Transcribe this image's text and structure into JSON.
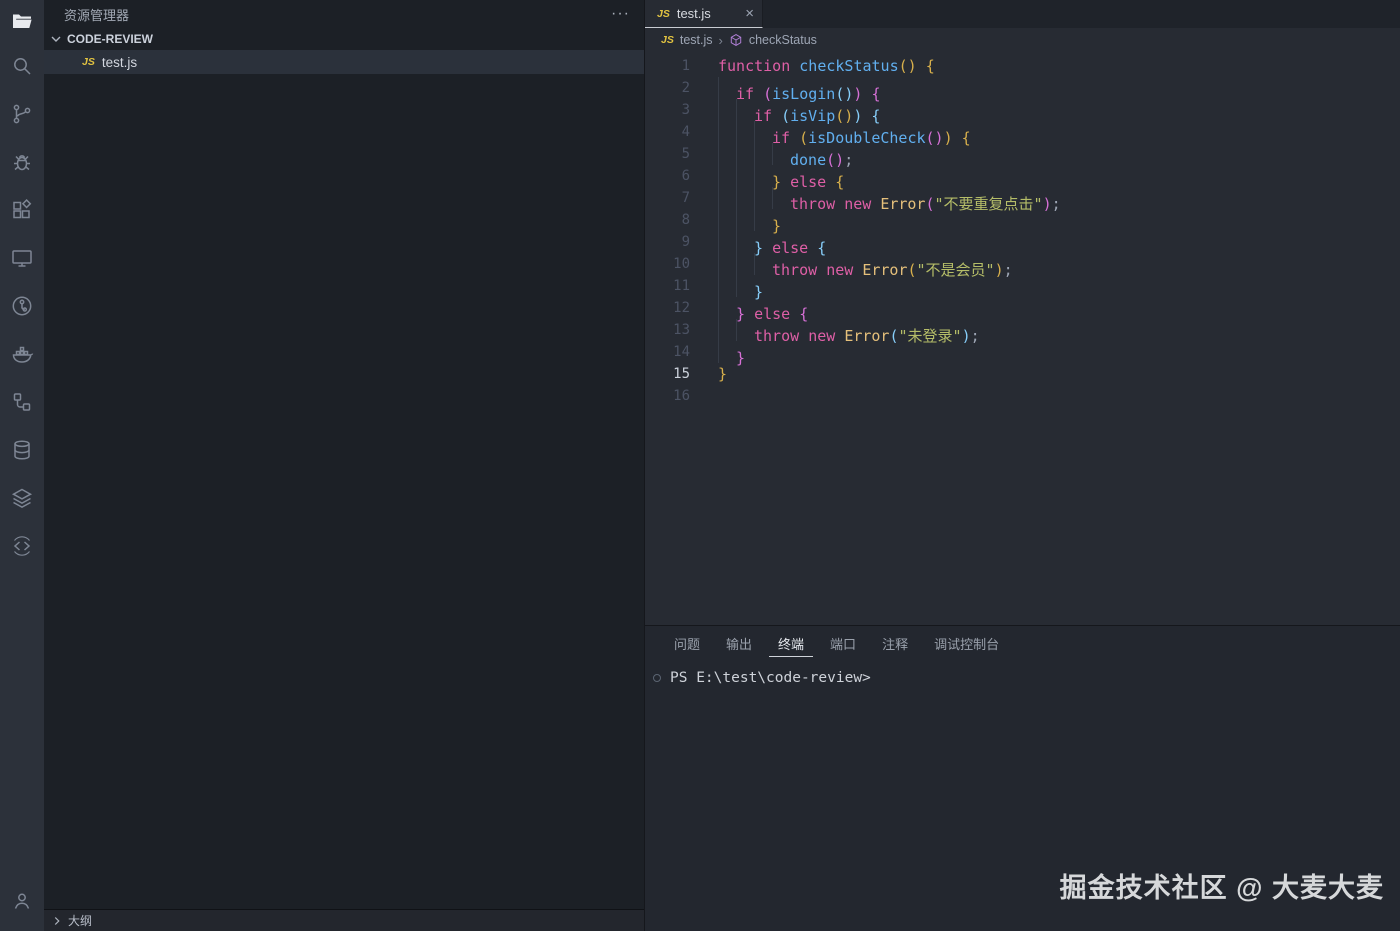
{
  "activity_bar": {
    "items": [
      {
        "name": "explorer",
        "active": true
      },
      {
        "name": "search",
        "active": false
      },
      {
        "name": "source-control",
        "active": false
      },
      {
        "name": "run-debug",
        "active": false
      },
      {
        "name": "extensions",
        "active": false
      },
      {
        "name": "remote-explorer",
        "active": false
      },
      {
        "name": "git-graph",
        "active": false
      },
      {
        "name": "docker",
        "active": false
      },
      {
        "name": "flow",
        "active": false
      },
      {
        "name": "database",
        "active": false
      },
      {
        "name": "layers",
        "active": false
      },
      {
        "name": "code-sync",
        "active": false
      }
    ],
    "bottom_item": {
      "name": "account",
      "active": false
    }
  },
  "sidebar": {
    "title": "资源管理器",
    "more_label": "···",
    "section_label": "CODE-REVIEW",
    "file": {
      "badge": "JS",
      "name": "test.js"
    },
    "outline_label": "大纲"
  },
  "editor": {
    "tab": {
      "badge": "JS",
      "title": "test.js",
      "close_label": "×"
    },
    "breadcrumb": {
      "badge": "JS",
      "file": "test.js",
      "separator": "›",
      "symbol": "checkStatus"
    },
    "code": {
      "language": "javascript",
      "lines": [
        {
          "n": "1",
          "indent": 0,
          "active": false,
          "tokens": [
            [
              "kw",
              "function"
            ],
            [
              "txt",
              " "
            ],
            [
              "fn",
              "checkStatus"
            ],
            [
              "b1",
              "()"
            ],
            [
              "txt",
              " "
            ],
            [
              "b1",
              "{"
            ]
          ]
        },
        {
          "n": "2",
          "indent": 2,
          "active": false,
          "tokens": [
            [
              "kw",
              "if"
            ],
            [
              "txt",
              " "
            ],
            [
              "b2",
              "("
            ],
            [
              "fn",
              "isLogin"
            ],
            [
              "b3",
              "()"
            ],
            [
              "b2",
              ")"
            ],
            [
              "txt",
              " "
            ],
            [
              "b2",
              "{"
            ]
          ]
        },
        {
          "n": "3",
          "indent": 4,
          "active": false,
          "tokens": [
            [
              "kw",
              "if"
            ],
            [
              "txt",
              " "
            ],
            [
              "b3",
              "("
            ],
            [
              "fn",
              "isVip"
            ],
            [
              "b1",
              "()"
            ],
            [
              "b3",
              ")"
            ],
            [
              "txt",
              " "
            ],
            [
              "b3",
              "{"
            ]
          ]
        },
        {
          "n": "4",
          "indent": 6,
          "active": false,
          "tokens": [
            [
              "kw",
              "if"
            ],
            [
              "txt",
              " "
            ],
            [
              "b1",
              "("
            ],
            [
              "fn",
              "isDoubleCheck"
            ],
            [
              "b2",
              "()"
            ],
            [
              "b1",
              ")"
            ],
            [
              "txt",
              " "
            ],
            [
              "b1",
              "{"
            ]
          ]
        },
        {
          "n": "5",
          "indent": 8,
          "active": false,
          "tokens": [
            [
              "fn",
              "done"
            ],
            [
              "b2",
              "()"
            ],
            [
              "pun",
              ";"
            ]
          ]
        },
        {
          "n": "6",
          "indent": 6,
          "active": false,
          "tokens": [
            [
              "b1",
              "}"
            ],
            [
              "txt",
              " "
            ],
            [
              "kw",
              "else"
            ],
            [
              "txt",
              " "
            ],
            [
              "b1",
              "{"
            ]
          ]
        },
        {
          "n": "7",
          "indent": 8,
          "active": false,
          "tokens": [
            [
              "kw",
              "throw"
            ],
            [
              "txt",
              " "
            ],
            [
              "kw",
              "new"
            ],
            [
              "txt",
              " "
            ],
            [
              "cls",
              "Error"
            ],
            [
              "b2",
              "("
            ],
            [
              "str",
              "\"不要重复点击\""
            ],
            [
              "b2",
              ")"
            ],
            [
              "pun",
              ";"
            ]
          ]
        },
        {
          "n": "8",
          "indent": 6,
          "active": false,
          "tokens": [
            [
              "b1",
              "}"
            ]
          ]
        },
        {
          "n": "9",
          "indent": 4,
          "active": false,
          "tokens": [
            [
              "b3",
              "}"
            ],
            [
              "txt",
              " "
            ],
            [
              "kw",
              "else"
            ],
            [
              "txt",
              " "
            ],
            [
              "b3",
              "{"
            ]
          ]
        },
        {
          "n": "10",
          "indent": 6,
          "active": false,
          "tokens": [
            [
              "kw",
              "throw"
            ],
            [
              "txt",
              " "
            ],
            [
              "kw",
              "new"
            ],
            [
              "txt",
              " "
            ],
            [
              "cls",
              "Error"
            ],
            [
              "b1",
              "("
            ],
            [
              "str",
              "\"不是会员\""
            ],
            [
              "b1",
              ")"
            ],
            [
              "pun",
              ";"
            ]
          ]
        },
        {
          "n": "11",
          "indent": 4,
          "active": false,
          "tokens": [
            [
              "b3",
              "}"
            ]
          ]
        },
        {
          "n": "12",
          "indent": 2,
          "active": false,
          "tokens": [
            [
              "b2",
              "}"
            ],
            [
              "txt",
              " "
            ],
            [
              "kw",
              "else"
            ],
            [
              "txt",
              " "
            ],
            [
              "b2",
              "{"
            ]
          ]
        },
        {
          "n": "13",
          "indent": 4,
          "active": false,
          "tokens": [
            [
              "kw",
              "throw"
            ],
            [
              "txt",
              " "
            ],
            [
              "kw",
              "new"
            ],
            [
              "txt",
              " "
            ],
            [
              "cls",
              "Error"
            ],
            [
              "b3",
              "("
            ],
            [
              "str",
              "\"未登录\""
            ],
            [
              "b3",
              ")"
            ],
            [
              "pun",
              ";"
            ]
          ]
        },
        {
          "n": "14",
          "indent": 2,
          "active": false,
          "tokens": [
            [
              "b2",
              "}"
            ]
          ]
        },
        {
          "n": "15",
          "indent": 0,
          "active": true,
          "tokens": [
            [
              "b1",
              "}"
            ]
          ]
        },
        {
          "n": "16",
          "indent": 0,
          "active": false,
          "tokens": []
        }
      ]
    }
  },
  "panel": {
    "tabs": [
      {
        "label": "问题",
        "active": false
      },
      {
        "label": "输出",
        "active": false
      },
      {
        "label": "终端",
        "active": true
      },
      {
        "label": "端口",
        "active": false
      },
      {
        "label": "注释",
        "active": false
      },
      {
        "label": "调试控制台",
        "active": false
      }
    ],
    "terminal": {
      "prompt": "PS E:\\test\\code-review>"
    }
  },
  "watermark": {
    "text": "掘金技术社区 @ 大麦大麦"
  },
  "colors": {
    "keyword": "#de5fa6",
    "function": "#61afef",
    "class": "#e5c07b",
    "string": "#b5bd68",
    "bracket_gold": "#d8b04c",
    "bracket_orchid": "#d670d6",
    "bracket_blue": "#87cefa",
    "js_badge": "#e2c341",
    "editor_bg": "#272b33",
    "sidebar_bg": "#1c2026",
    "activitybar_bg": "#2c313a"
  }
}
